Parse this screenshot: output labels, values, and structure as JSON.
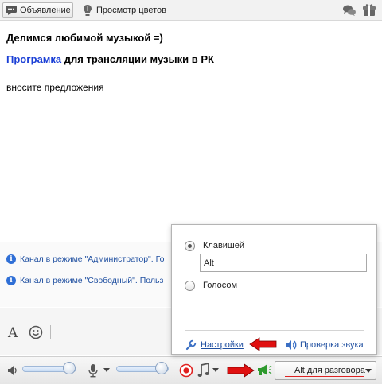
{
  "toolbar": {
    "announcement_label": "Объявление",
    "color_preview_label": "Просмотр цветов"
  },
  "content": {
    "heading": "Делимся любимой музыкой =)",
    "program_link": "Програмка",
    "program_rest": " для трансляции музыки в РК",
    "suggestions": "вносите предложения"
  },
  "notices": [
    {
      "text": "Канал в режиме \"Администратор\". Го"
    },
    {
      "text": "Канал в режиме \"Свободный\". Польз"
    }
  ],
  "popup": {
    "key_option_label": "Клавишей",
    "key_value": "Alt",
    "voice_option_label": "Голосом",
    "selected_option": "key",
    "settings_link": "Настройки",
    "sound_check_link": "Проверка звука"
  },
  "bottombar": {
    "volume_level": 0.88,
    "mic_level": 0.87,
    "ptt_label": "Alt для разговора"
  },
  "colors": {
    "link": "#1a3fd6",
    "notice_text": "#1f4fa0",
    "record_red": "#e0201f",
    "arrow_red": "#e01010",
    "megaphone_green": "#2e9a2e"
  },
  "icons": [
    "announcement-icon",
    "color-preview-icon",
    "chat-bubbles-icon",
    "gift-icon",
    "info-icon",
    "font-icon",
    "smiley-icon",
    "speaker-icon",
    "microphone-icon",
    "record-icon",
    "music-note-icon",
    "megaphone-icon",
    "wrench-icon",
    "sound-check-icon"
  ]
}
